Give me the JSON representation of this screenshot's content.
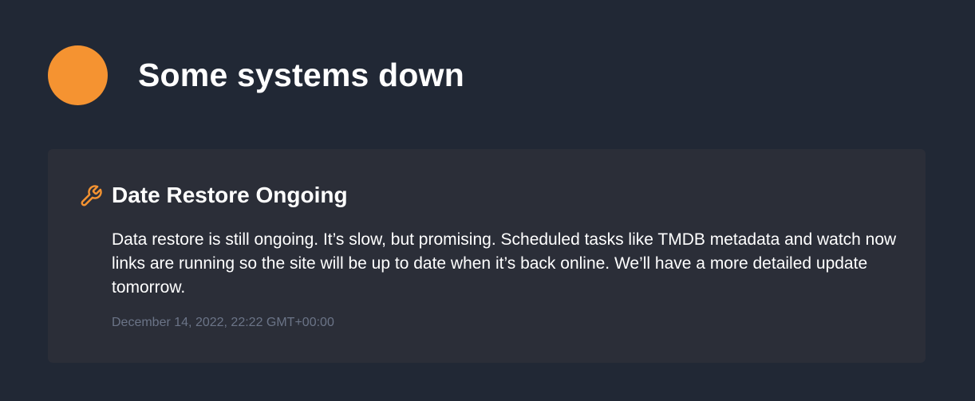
{
  "status": {
    "title": "Some systems down",
    "indicator_color": "#f59331"
  },
  "incident": {
    "icon": "wrench-icon",
    "icon_color": "#f59331",
    "title": "Date Restore Ongoing",
    "body": "Data restore is still ongoing. It’s slow, but promising. Scheduled tasks like TMDB metadata and watch now links are running so the site will be up to date when it’s back online. We’ll have a more detailed update tomorrow.",
    "timestamp": "December 14, 2022, 22:22 GMT+00:00"
  }
}
